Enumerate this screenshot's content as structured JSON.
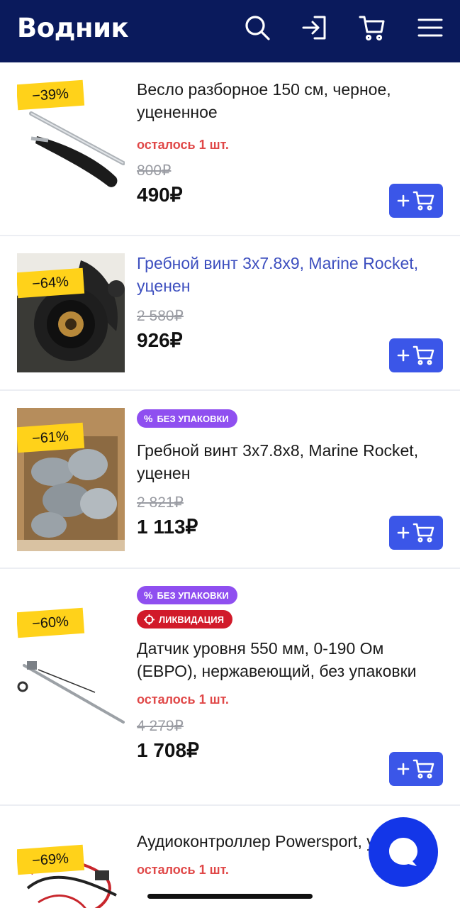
{
  "header": {
    "logo": "Водник",
    "icons": [
      "search-icon",
      "login-icon",
      "cart-icon",
      "menu-icon"
    ],
    "background": "#0a1a5c"
  },
  "products": [
    {
      "discount": "−39%",
      "title": "Весло разборное 150 см, черное, уцененное",
      "stock": "осталось 1 шт.",
      "old_price": "800₽",
      "price": "490₽"
    },
    {
      "discount": "−64%",
      "title": "Гребной винт 3x7.8x9, Marine Rocket, уценен",
      "old_price": "2 580₽",
      "price": "926₽"
    },
    {
      "discount": "−61%",
      "badge": "БЕЗ УПАКОВКИ",
      "title": "Гребной винт 3x7.8x8, Marine Rocket, уценен",
      "old_price": "2 821₽",
      "price": "1 113₽"
    },
    {
      "discount": "−60%",
      "badge": "БЕЗ УПАКОВКИ",
      "badge2": "ЛИКВИДАЦИЯ",
      "title": "Датчик уровня 550 мм, 0-190 Ом (ЕВРО), нержавеющий, без упаковки",
      "stock": "осталось 1 шт.",
      "old_price": "4 279₽",
      "price": "1 708₽"
    },
    {
      "discount": "−69%",
      "title": "Аудиоконтроллер Powersport, уценен",
      "stock": "осталось 1 шт."
    }
  ],
  "colors": {
    "accent": "#3b56e8",
    "stock": "#e04848",
    "discount": "#ffd21a",
    "badge_purple": "#8f4ff0",
    "badge_red": "#d11a2a",
    "chat": "#1336e8"
  }
}
